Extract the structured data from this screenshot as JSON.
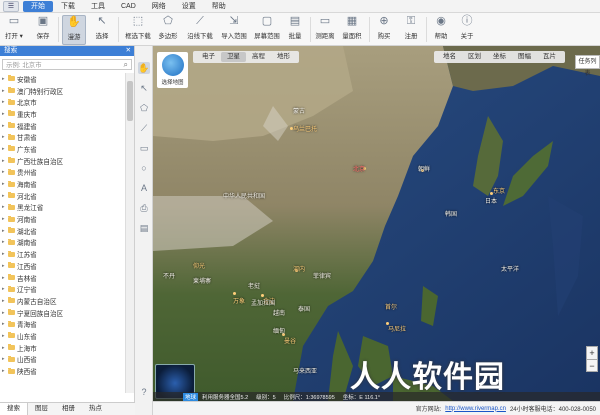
{
  "menu": {
    "app_icon": "menu-icon",
    "items": [
      "开始",
      "下载",
      "工具",
      "CAD",
      "网络",
      "设置",
      "帮助"
    ],
    "active": "开始"
  },
  "ribbon": {
    "items": [
      {
        "label": "打开 ▾",
        "icon": "folder-open-icon"
      },
      {
        "label": "保存",
        "icon": "save-icon"
      },
      {
        "label": "漫游",
        "icon": "hand-icon"
      },
      {
        "label": "选择",
        "icon": "cursor-icon"
      },
      {
        "label": "框选下载",
        "icon": "box-select-icon"
      },
      {
        "label": "多边形",
        "icon": "polygon-icon"
      },
      {
        "label": "沿线下载",
        "icon": "line-download-icon"
      },
      {
        "label": "导入范围",
        "icon": "import-icon"
      },
      {
        "label": "屏幕范围",
        "icon": "screen-icon"
      },
      {
        "label": "批量",
        "icon": "batch-icon"
      },
      {
        "label": "测距离",
        "icon": "ruler-icon"
      },
      {
        "label": "量面积",
        "icon": "area-icon"
      },
      {
        "label": "购买",
        "icon": "cart-icon"
      },
      {
        "label": "注册",
        "icon": "register-icon"
      },
      {
        "label": "帮助",
        "icon": "help-icon"
      },
      {
        "label": "关于",
        "icon": "info-icon"
      }
    ]
  },
  "panel": {
    "title": "搜索",
    "close": "✕",
    "search_placeholder": "示例: 北京市",
    "tree": [
      "安徽省",
      "澳门特别行政区",
      "北京市",
      "重庆市",
      "福建省",
      "甘肃省",
      "广东省",
      "广西壮族自治区",
      "贵州省",
      "海南省",
      "河北省",
      "黑龙江省",
      "河南省",
      "湖北省",
      "湖南省",
      "江苏省",
      "江西省",
      "吉林省",
      "辽宁省",
      "内蒙古自治区",
      "宁夏回族自治区",
      "青海省",
      "山东省",
      "上海市",
      "山西省",
      "陕西省"
    ],
    "tabs": [
      "搜索",
      "图层",
      "相册",
      "热点"
    ],
    "active_tab": "搜索"
  },
  "map": {
    "logo_text": "选择地图",
    "type_tabs": [
      "电子",
      "卫星",
      "高程",
      "地形"
    ],
    "active_type": "卫星",
    "overlay_tabs": [
      "地名",
      "区划",
      "坐标",
      "图幅",
      "瓦片"
    ],
    "task_list": "任务列表",
    "labels": [
      {
        "text": "中华人民共和国",
        "cls": ""
      },
      {
        "text": "北京",
        "cls": "r"
      },
      {
        "text": "日本",
        "cls": ""
      },
      {
        "text": "韩国",
        "cls": ""
      },
      {
        "text": "朝鲜",
        "cls": ""
      },
      {
        "text": "蒙古",
        "cls": ""
      },
      {
        "text": "乌兰巴托",
        "cls": "o"
      },
      {
        "text": "东京",
        "cls": "o"
      },
      {
        "text": "首尔",
        "cls": "o"
      },
      {
        "text": "菲律宾",
        "cls": ""
      },
      {
        "text": "越南",
        "cls": ""
      },
      {
        "text": "泰国",
        "cls": ""
      },
      {
        "text": "老挝",
        "cls": ""
      },
      {
        "text": "缅甸",
        "cls": ""
      },
      {
        "text": "柬埔寨",
        "cls": ""
      },
      {
        "text": "马来西亚",
        "cls": ""
      },
      {
        "text": "太平洋",
        "cls": ""
      },
      {
        "text": "马尼拉",
        "cls": "o"
      },
      {
        "text": "河内",
        "cls": "o"
      },
      {
        "text": "曼谷",
        "cls": "o"
      },
      {
        "text": "金边",
        "cls": "o"
      },
      {
        "text": "万象",
        "cls": "o"
      },
      {
        "text": "仰光",
        "cls": "o"
      },
      {
        "text": "不丹",
        "cls": ""
      },
      {
        "text": "孟加拉国",
        "cls": ""
      }
    ],
    "zoom_in": "+",
    "zoom_out": "−"
  },
  "status": {
    "net": "地球",
    "server": "利用服务器全国5.2",
    "level": "级别：5",
    "scale": "比例尺：1:36978595",
    "coords": "坐标：E 116.1°"
  },
  "bottom": {
    "site_label": "官方网站:",
    "site": "http://www.rivermap.cn",
    "hotline": "24小时客服电话：400-028-0050"
  },
  "watermark": "人人软件园"
}
